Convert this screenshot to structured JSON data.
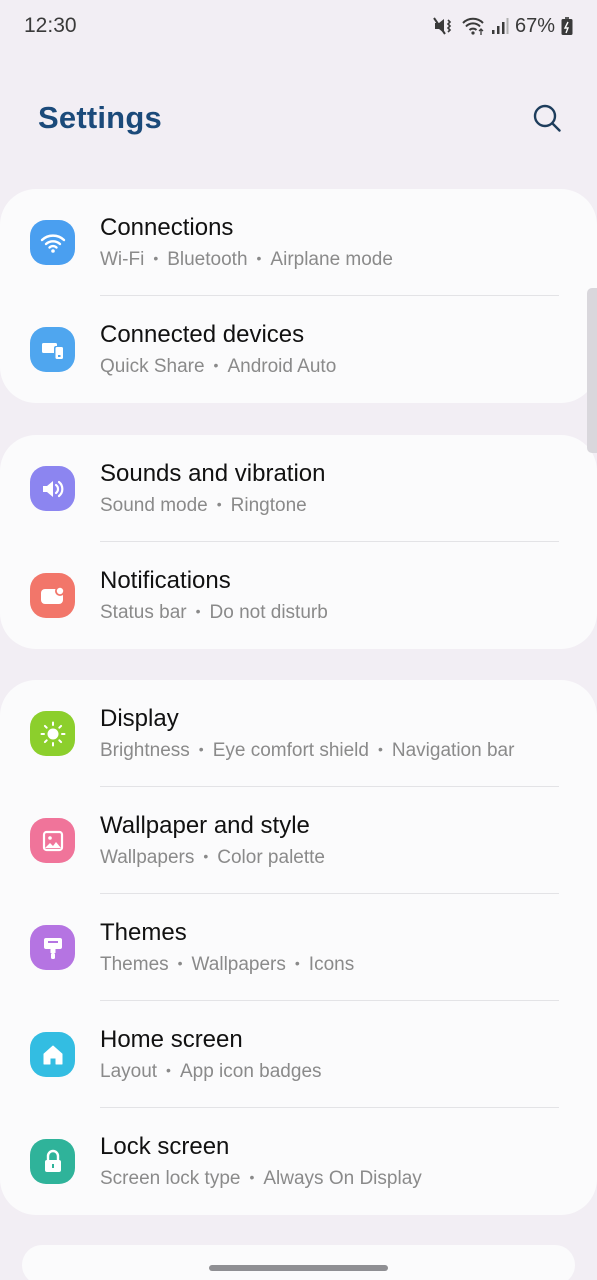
{
  "status_bar": {
    "time": "12:30",
    "battery": "67%",
    "icons": [
      "mute-vibrate-icon",
      "wifi-icon",
      "signal-icon",
      "battery-charging-icon"
    ]
  },
  "header": {
    "title": "Settings",
    "search_icon": "search-icon"
  },
  "colors": {
    "title": "#1b4a7a",
    "connections": "#4a9ff0",
    "connected_devices": "#4fa6ef",
    "sounds": "#8c85f0",
    "notifications": "#f2766a",
    "display": "#8ccf2c",
    "wallpaper": "#f0749a",
    "themes": "#b574e2",
    "home_screen": "#33bde2",
    "lock_screen": "#2fb39a"
  },
  "groups": [
    {
      "items": [
        {
          "title": "Connections",
          "subtitle": [
            "Wi-Fi",
            "Bluetooth",
            "Airplane mode"
          ],
          "icon": "wifi-icon"
        },
        {
          "title": "Connected devices",
          "subtitle": [
            "Quick Share",
            "Android Auto"
          ],
          "icon": "devices-icon"
        }
      ]
    },
    {
      "items": [
        {
          "title": "Sounds and vibration",
          "subtitle": [
            "Sound mode",
            "Ringtone"
          ],
          "icon": "speaker-icon"
        },
        {
          "title": "Notifications",
          "subtitle": [
            "Status bar",
            "Do not disturb"
          ],
          "icon": "notification-icon"
        }
      ]
    },
    {
      "items": [
        {
          "title": "Display",
          "subtitle": [
            "Brightness",
            "Eye comfort shield",
            "Navigation bar"
          ],
          "icon": "sun-icon"
        },
        {
          "title": "Wallpaper and style",
          "subtitle": [
            "Wallpapers",
            "Color palette"
          ],
          "icon": "image-icon"
        },
        {
          "title": "Themes",
          "subtitle": [
            "Themes",
            "Wallpapers",
            "Icons"
          ],
          "icon": "paintbrush-icon"
        },
        {
          "title": "Home screen",
          "subtitle": [
            "Layout",
            "App icon badges"
          ],
          "icon": "home-icon"
        },
        {
          "title": "Lock screen",
          "subtitle": [
            "Screen lock type",
            "Always On Display"
          ],
          "icon": "lock-icon"
        }
      ]
    }
  ]
}
